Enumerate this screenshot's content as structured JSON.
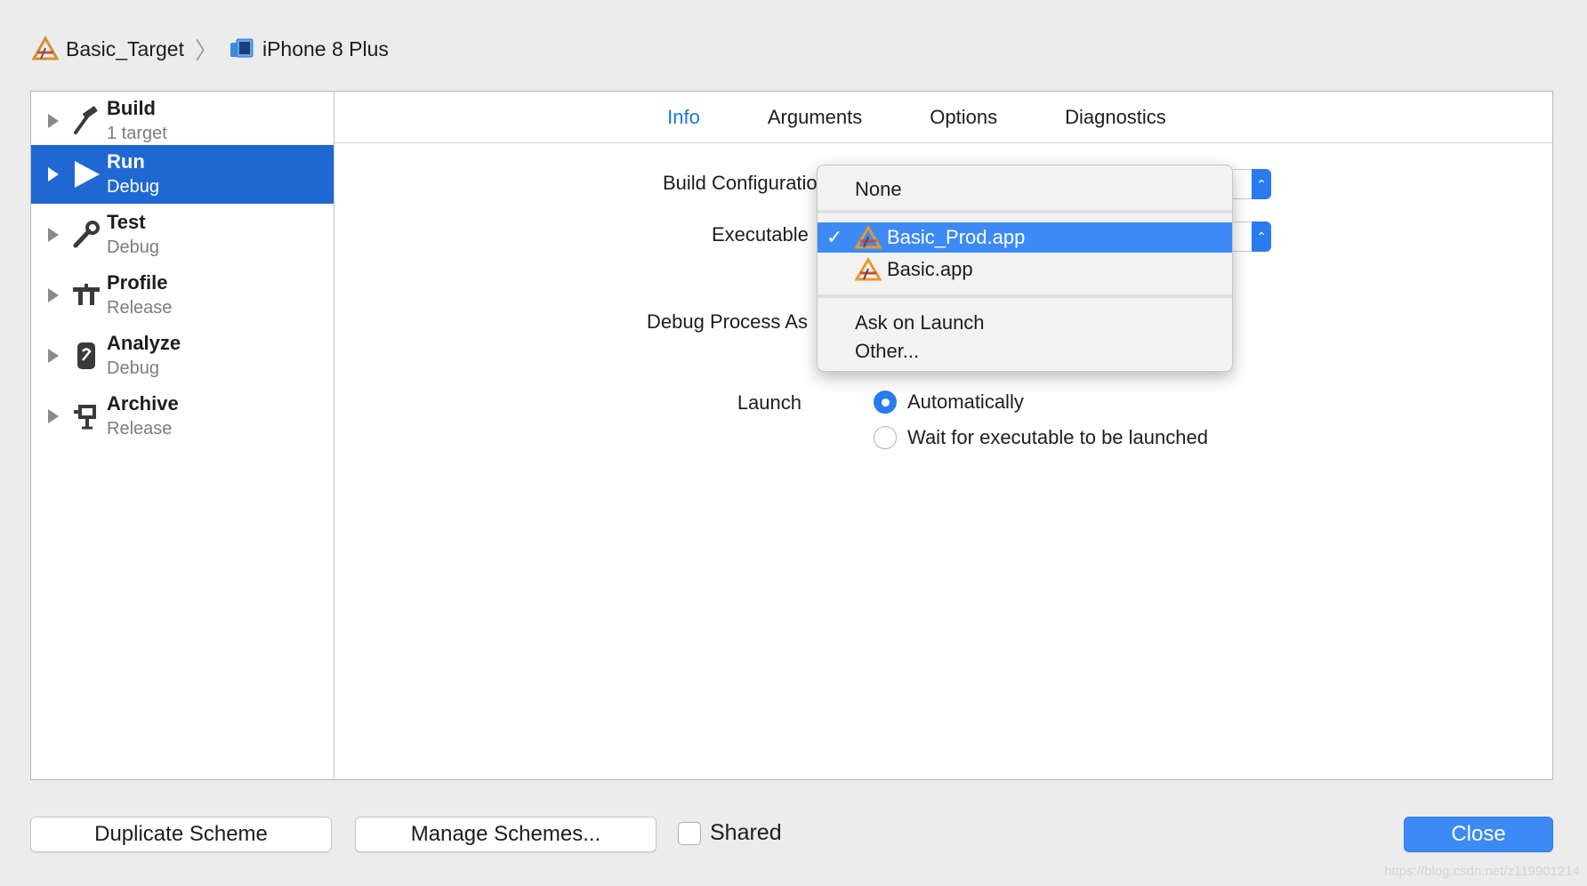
{
  "breadcrumb": {
    "target": "Basic_Target",
    "device": "iPhone 8 Plus"
  },
  "sidebar": {
    "items": [
      {
        "title": "Build",
        "sub": "1 target",
        "icon": "hammer-icon"
      },
      {
        "title": "Run",
        "sub": "Debug",
        "icon": "play-icon"
      },
      {
        "title": "Test",
        "sub": "Debug",
        "icon": "wrench-icon"
      },
      {
        "title": "Profile",
        "sub": "Release",
        "icon": "instruments-icon"
      },
      {
        "title": "Analyze",
        "sub": "Debug",
        "icon": "analyze-icon"
      },
      {
        "title": "Archive",
        "sub": "Release",
        "icon": "archive-icon"
      }
    ]
  },
  "tabs": [
    "Info",
    "Arguments",
    "Options",
    "Diagnostics"
  ],
  "form": {
    "build_configuration_label": "Build Configuration",
    "executable_label": "Executable",
    "debug_process_label": "Debug Process As",
    "launch_label": "Launch",
    "launch_options": [
      "Automatically",
      "Wait for executable to be launched"
    ]
  },
  "menu": {
    "items": [
      "None",
      "Basic_Prod.app",
      "Basic.app",
      "Ask on Launch",
      "Other..."
    ],
    "checkmark": "✓"
  },
  "footer": {
    "duplicate": "Duplicate Scheme",
    "manage": "Manage Schemes...",
    "shared": "Shared",
    "close": "Close"
  },
  "watermark": "https://blog.csdn.net/z119901214",
  "colors": {
    "accent": "#1f68d2",
    "tab_active": "#1a74e8",
    "menu_highlight": "#3d8af7"
  }
}
